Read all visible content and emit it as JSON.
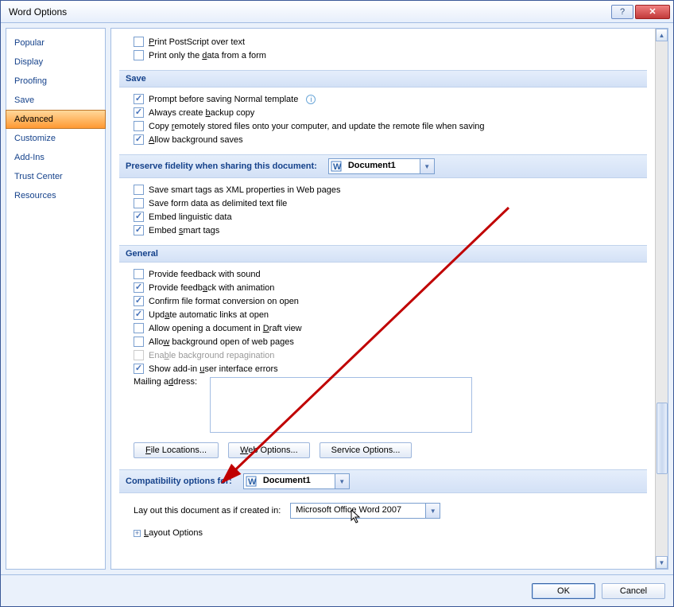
{
  "window": {
    "title": "Word Options"
  },
  "sidebar": {
    "items": [
      {
        "label": "Popular"
      },
      {
        "label": "Display"
      },
      {
        "label": "Proofing"
      },
      {
        "label": "Save"
      },
      {
        "label": "Advanced",
        "selected": true
      },
      {
        "label": "Customize"
      },
      {
        "label": "Add-Ins"
      },
      {
        "label": "Trust Center"
      },
      {
        "label": "Resources"
      }
    ]
  },
  "top_checks": [
    {
      "label": "Print PostScript over text",
      "u": "P",
      "checked": false
    },
    {
      "label": "Print only the data from a form",
      "u": "d",
      "checked": false
    }
  ],
  "save_header": "Save",
  "save_checks": [
    {
      "label": "Prompt before saving Normal template",
      "checked": true,
      "info": true
    },
    {
      "label": "Always create backup copy",
      "u": "b",
      "checked": true
    },
    {
      "label": "Copy remotely stored files onto your computer, and update the remote file when saving",
      "u": "r",
      "checked": false
    },
    {
      "label": "Allow background saves",
      "u": "A",
      "checked": true
    }
  ],
  "preserve_header": "Preserve fidelity when sharing this document:",
  "preserve_doc": "Document1",
  "preserve_checks": [
    {
      "label": "Save smart tags as XML properties in Web pages",
      "checked": false
    },
    {
      "label": "Save form data as delimited text file",
      "checked": false
    },
    {
      "label": "Embed linguistic data",
      "checked": true
    },
    {
      "label": "Embed smart tags",
      "u": "s",
      "checked": true
    }
  ],
  "general_header": "General",
  "general_checks": [
    {
      "label": "Provide feedback with sound",
      "checked": false
    },
    {
      "label": "Provide feedback with animation",
      "u": "a",
      "checked": true
    },
    {
      "label": "Confirm file format conversion on open",
      "checked": true
    },
    {
      "label": "Update automatic links at open",
      "u": "a",
      "checked": true
    },
    {
      "label": "Allow opening a document in Draft view",
      "u": "D",
      "checked": false
    },
    {
      "label": "Allow background open of web pages",
      "u": "w",
      "checked": false
    },
    {
      "label": "Enable background repagination",
      "u": "b",
      "checked": false,
      "disabled": true
    },
    {
      "label": "Show add-in user interface errors",
      "u": "u",
      "checked": true
    }
  ],
  "mailing_label": "Mailing address:",
  "mailing_u": "d",
  "buttons": {
    "file_locations": "File Locations...",
    "web_options": "Web Options...",
    "service_options": "Service Options..."
  },
  "compat_header": "Compatibility options for:",
  "compat_doc": "Document1",
  "layout_label": "Lay out this document as if created in:",
  "layout_value": "Microsoft Office Word 2007",
  "layout_options": "Layout Options",
  "layout_u": "L",
  "footer": {
    "ok": "OK",
    "cancel": "Cancel"
  }
}
